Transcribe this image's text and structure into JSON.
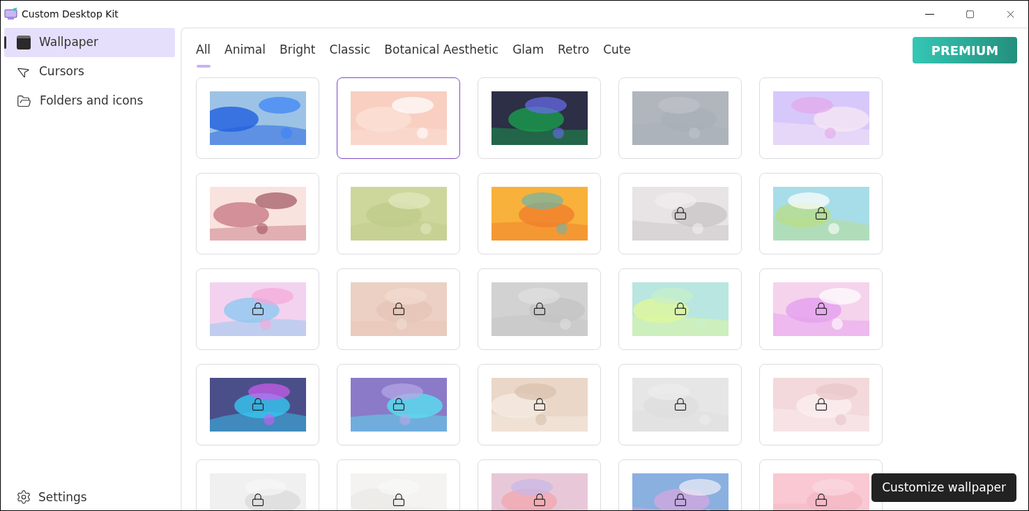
{
  "window": {
    "title": "Custom Desktop Kit"
  },
  "sidebar": {
    "items": [
      {
        "label": "Wallpaper",
        "kind": "wallpaper",
        "selected": true
      },
      {
        "label": "Cursors",
        "kind": "cursor",
        "selected": false
      },
      {
        "label": "Folders and icons",
        "kind": "folder",
        "selected": false
      }
    ],
    "settings": {
      "label": "Settings"
    }
  },
  "tabs": [
    {
      "label": "All",
      "selected": true
    },
    {
      "label": "Animal",
      "selected": false
    },
    {
      "label": "Bright",
      "selected": false
    },
    {
      "label": "Classic",
      "selected": false
    },
    {
      "label": "Botanical Aesthetic",
      "selected": false
    },
    {
      "label": "Glam",
      "selected": false
    },
    {
      "label": "Retro",
      "selected": false
    },
    {
      "label": "Cute",
      "selected": false
    }
  ],
  "premium_button": "PREMIUM",
  "wallpapers": [
    {
      "selected": false,
      "locked": false
    },
    {
      "selected": true,
      "locked": false
    },
    {
      "selected": false,
      "locked": false
    },
    {
      "selected": false,
      "locked": false
    },
    {
      "selected": false,
      "locked": false
    },
    {
      "selected": false,
      "locked": false
    },
    {
      "selected": false,
      "locked": false
    },
    {
      "selected": false,
      "locked": false
    },
    {
      "selected": false,
      "locked": true
    },
    {
      "selected": false,
      "locked": true
    },
    {
      "selected": false,
      "locked": true
    },
    {
      "selected": false,
      "locked": true
    },
    {
      "selected": false,
      "locked": true
    },
    {
      "selected": false,
      "locked": true
    },
    {
      "selected": false,
      "locked": true
    },
    {
      "selected": false,
      "locked": true
    },
    {
      "selected": false,
      "locked": true
    },
    {
      "selected": false,
      "locked": true
    },
    {
      "selected": false,
      "locked": true
    },
    {
      "selected": false,
      "locked": true
    },
    {
      "selected": false,
      "locked": true
    },
    {
      "selected": false,
      "locked": true
    },
    {
      "selected": false,
      "locked": true
    },
    {
      "selected": false,
      "locked": true
    },
    {
      "selected": false,
      "locked": true
    }
  ],
  "tooltip": "Customize wallpaper"
}
